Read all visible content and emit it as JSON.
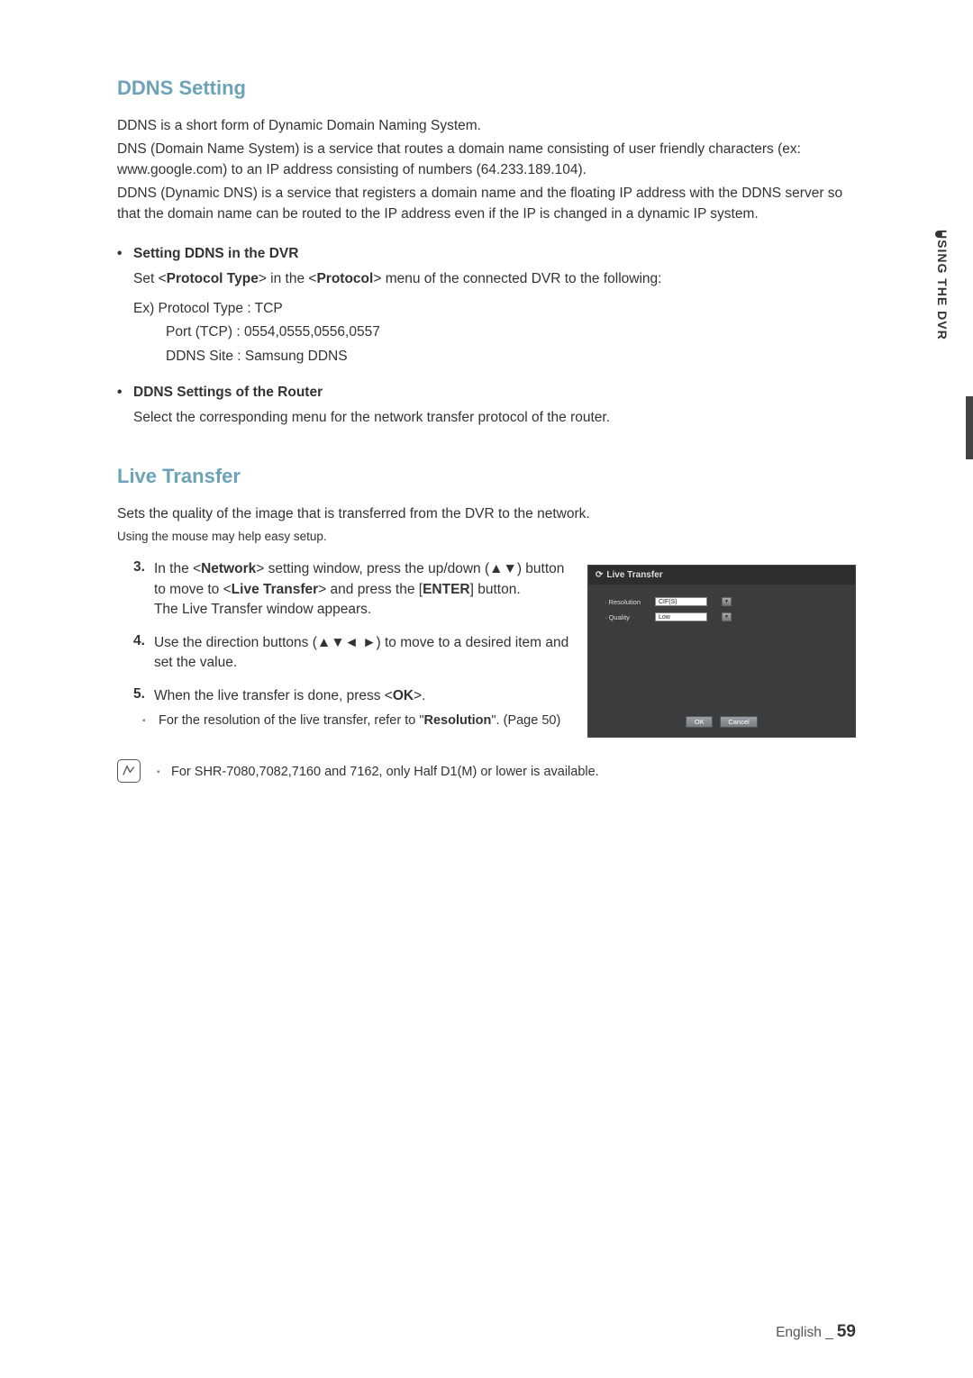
{
  "side": {
    "label": "USING THE DVR"
  },
  "ddns": {
    "heading": "DDNS Setting",
    "intro1": "DDNS is a short form of Dynamic Domain Naming System.",
    "intro2": "DNS (Domain Name System) is a service that routes a domain name consisting of user friendly characters (ex: www.google.com) to an IP address consisting of numbers (64.233.189.104).",
    "intro3": "DDNS (Dynamic DNS) is a service that registers a domain name and the floating IP address with the DDNS server so that the domain name can be routed to the IP address even if the IP is changed in a dynamic IP system.",
    "sub1_heading": "Setting DDNS in the DVR",
    "sub1_text_prefix": "Set <",
    "sub1_text_bold1": "Protocol Type",
    "sub1_text_mid": "> in the <",
    "sub1_text_bold2": "Protocol",
    "sub1_text_suffix": "> menu of the connected DVR to the following:",
    "ex_line1": "Ex) Protocol Type : TCP",
    "ex_line2": "Port (TCP) : 0554,0555,0556,0557",
    "ex_line3": "DDNS Site : Samsung DDNS",
    "sub2_heading": "DDNS Settings of the Router",
    "sub2_text": "Select the corresponding menu for the network transfer protocol of the router."
  },
  "live": {
    "heading": "Live Transfer",
    "intro": "Sets the quality of the image that is transferred from the DVR to the network.",
    "subtitle": "Using the mouse may help easy setup.",
    "step3_num": "3.",
    "step3_a": "In the <",
    "step3_bold1": "Network",
    "step3_b": "> setting window, press the up/down (▲▼) button to move to <",
    "step3_bold2": "Live Transfer",
    "step3_c": "> and press the [",
    "step3_bold3": "ENTER",
    "step3_d": "] button.",
    "step3_line2": "The Live Transfer window appears.",
    "step4_num": "4.",
    "step4_text": "Use the direction buttons (▲▼◄ ►) to move to a desired item and set the value.",
    "step5_num": "5.",
    "step5_a": "When the live transfer is done, press <",
    "step5_bold": "OK",
    "step5_b": ">.",
    "sub_a": "For the resolution of the live transfer, refer to \"",
    "sub_bold": "Resolution",
    "sub_b": "\". (Page 50)",
    "note": "For SHR-7080,7082,7160 and 7162, only Half D1(M) or lower is available."
  },
  "screenshot": {
    "title": "Live Transfer",
    "row1_label": "· Resolution",
    "row1_value": "CIF(S)",
    "row2_label": "· Quality",
    "row2_value": "Low",
    "ok": "OK",
    "cancel": "Cancel"
  },
  "footer": {
    "lang": "English _",
    "page": "59"
  }
}
